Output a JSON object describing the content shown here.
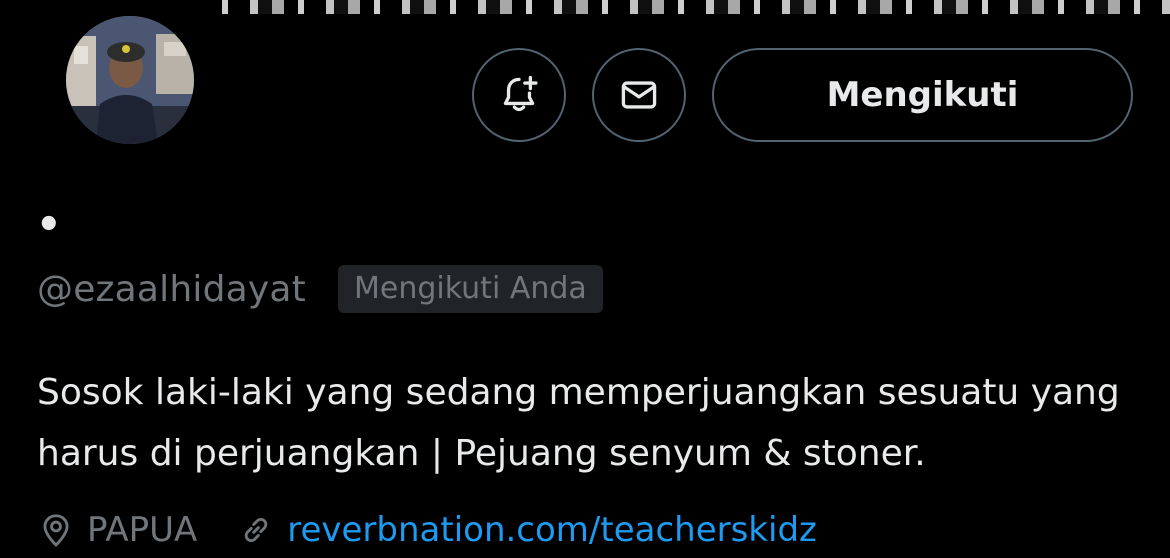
{
  "profile": {
    "display_name": "•",
    "handle": "@ezaalhidayat",
    "follows_you_badge": "Mengikuti Anda",
    "bio": "Sosok laki-laki yang sedang memperjuangkan sesuatu yang harus di perjuangkan | Pejuang senyum & stoner.",
    "location": "PAPUA",
    "website": "reverbnation.com/teacherskidz"
  },
  "actions": {
    "notify_icon": "bell-plus-icon",
    "message_icon": "envelope-icon",
    "follow_label": "Mengikuti"
  },
  "colors": {
    "background": "#000000",
    "primary_text": "#e7e9ea",
    "secondary_text": "#71767b",
    "link": "#1d9bf0",
    "border": "#536471",
    "badge_bg": "#202327"
  }
}
